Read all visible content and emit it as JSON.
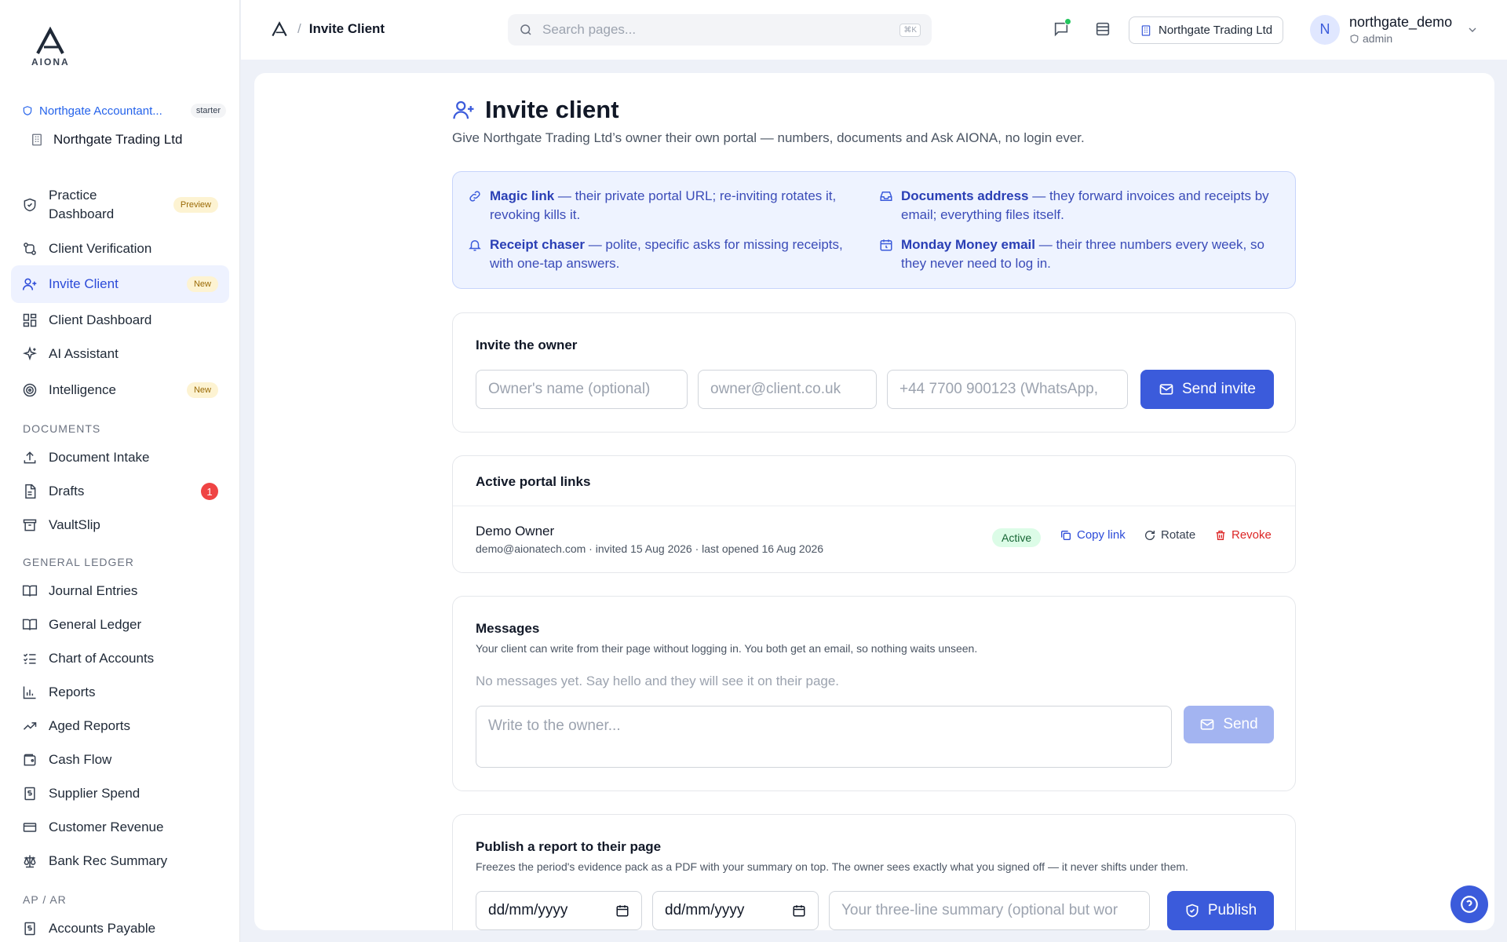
{
  "brand": {
    "name": "AIONA"
  },
  "sidebar": {
    "org_name": "Northgate Accountant...",
    "plan": "starter",
    "client": "Northgate Trading Ltd",
    "items": [
      {
        "label": "Practice Dashboard",
        "badge": "Preview"
      },
      {
        "label": "Client Verification"
      },
      {
        "label": "Invite Client",
        "badge": "New"
      },
      {
        "label": "Client Dashboard"
      },
      {
        "label": "AI Assistant"
      },
      {
        "label": "Intelligence",
        "badge": "New"
      }
    ],
    "sections": {
      "documents": "DOCUMENTS",
      "general_ledger": "GENERAL LEDGER",
      "ap_ar": "AP / AR"
    },
    "doc_items": [
      {
        "label": "Document Intake"
      },
      {
        "label": "Drafts",
        "count": "1"
      },
      {
        "label": "VaultSlip"
      }
    ],
    "gl_items": [
      {
        "label": "Journal Entries"
      },
      {
        "label": "General Ledger"
      },
      {
        "label": "Chart of Accounts"
      },
      {
        "label": "Reports"
      },
      {
        "label": "Aged Reports"
      },
      {
        "label": "Cash Flow"
      },
      {
        "label": "Supplier Spend"
      },
      {
        "label": "Customer Revenue"
      },
      {
        "label": "Bank Rec Summary"
      }
    ],
    "ap_items": [
      {
        "label": "Accounts Payable"
      }
    ]
  },
  "topbar": {
    "breadcrumb": "Invite Client",
    "search_placeholder": "Search pages...",
    "shortcut": "⌘K",
    "org_button": "Northgate Trading Ltd",
    "user": {
      "initial": "N",
      "name": "northgate_demo",
      "role": "admin"
    }
  },
  "page": {
    "title": "Invite client",
    "subtitle": "Give Northgate Trading Ltd’s owner their own portal — numbers, documents and Ask AIONA, no login ever."
  },
  "info": [
    {
      "title": "Magic link",
      "text": "— their private portal URL; re-inviting rotates it, revoking kills it."
    },
    {
      "title": "Documents address",
      "text": "— they forward invoices and receipts by email; everything files itself."
    },
    {
      "title": "Receipt chaser",
      "text": "— polite, specific asks for missing receipts, with one-tap answers."
    },
    {
      "title": "Monday Money email",
      "text": "— their three numbers every week, so they never need to log in."
    }
  ],
  "invite": {
    "heading": "Invite the owner",
    "name_placeholder": "Owner's name (optional)",
    "email_placeholder": "owner@client.co.uk",
    "phone_placeholder": "+44 7700 900123 (WhatsApp,",
    "button": "Send invite"
  },
  "links": {
    "heading": "Active portal links",
    "rows": [
      {
        "name": "Demo Owner",
        "meta": "demo@aionatech.com · invited 15 Aug 2026 · last opened 16 Aug 2026",
        "status": "Active",
        "copy": "Copy link",
        "rotate": "Rotate",
        "revoke": "Revoke"
      }
    ]
  },
  "messages": {
    "heading": "Messages",
    "desc": "Your client can write from their page without logging in. You both get an email, so nothing waits unseen.",
    "empty": "No messages yet. Say hello and they will see it on their page.",
    "placeholder": "Write to the owner...",
    "button": "Send"
  },
  "publish": {
    "heading": "Publish a report to their page",
    "desc": "Freezes the period's evidence pack as a PDF with your summary on top. The owner sees exactly what you signed off — it never shifts under them.",
    "date_from": "dd/mm/yyyy",
    "date_to": "dd/mm/yyyy",
    "summary_placeholder": "Your three-line summary (optional but wor",
    "button": "Publish"
  },
  "colors": {
    "accent": "#3b5bdb",
    "active_nav_bg": "#eef2ff",
    "danger": "#dc2626",
    "success_bg": "#dcfce7"
  }
}
